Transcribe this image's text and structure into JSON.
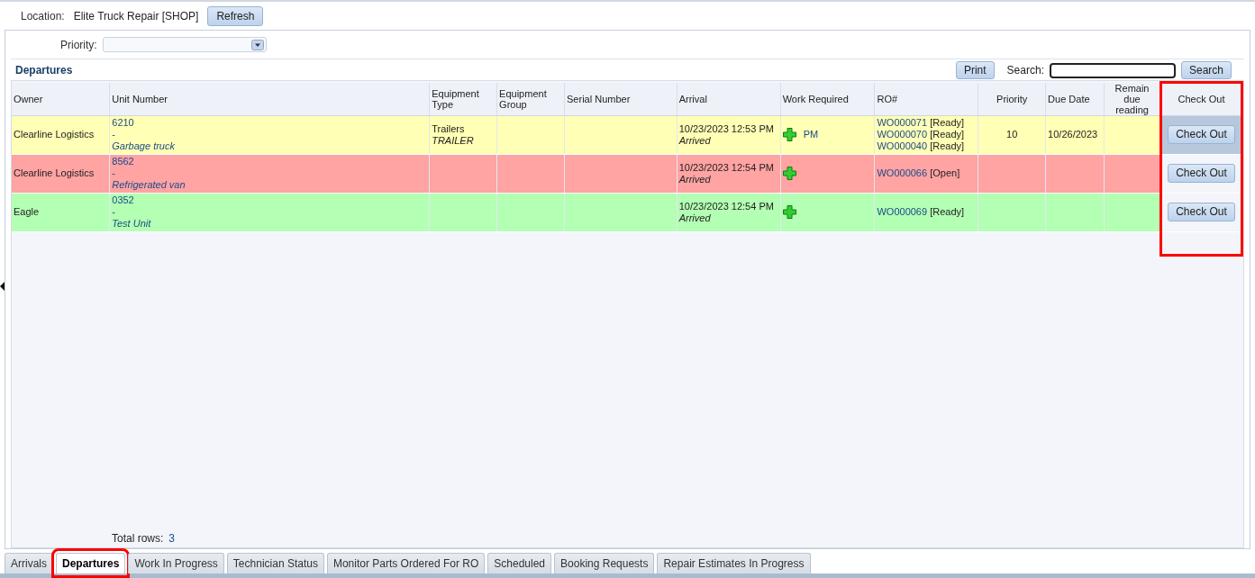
{
  "location": {
    "label": "Location:",
    "value": "Elite Truck Repair [SHOP]"
  },
  "refresh_button": "Refresh",
  "priority_filter": {
    "label": "Priority:"
  },
  "grid": {
    "title": "Departures",
    "print_button": "Print",
    "search_label": "Search:",
    "search_button": "Search",
    "columns": [
      {
        "label": "Owner",
        "highlighted": false
      },
      {
        "label": "Unit Number",
        "highlighted": false
      },
      {
        "label": "Equipment Type",
        "highlighted": false
      },
      {
        "label": "Equipment Group",
        "highlighted": false
      },
      {
        "label": "Serial Number",
        "highlighted": false
      },
      {
        "label": "Arrival",
        "highlighted": false
      },
      {
        "label": "Work Required",
        "highlighted": false
      },
      {
        "label": "RO#",
        "highlighted": false
      },
      {
        "label": "Priority",
        "highlighted": false
      },
      {
        "label": "Due Date",
        "highlighted": false
      },
      {
        "label": "Remain due reading",
        "highlighted": false
      },
      {
        "label": "Check Out",
        "highlighted": true
      }
    ],
    "rows": [
      {
        "color": "#ffffb5",
        "selected": true,
        "owner": "Clearline Logistics",
        "unit_number": "6210",
        "unit_separator": "-",
        "unit_description": "Garbage truck",
        "equipment_type": "Trailers",
        "equipment_type_code": "TRAILER",
        "arrival": "10/23/2023 12:53 PM",
        "arrival_status": "Arrived",
        "work_required": "PM",
        "ro": [
          {
            "number": "WO000071",
            "status": "[Ready]"
          },
          {
            "number": "WO000070",
            "status": "[Ready]"
          },
          {
            "number": "WO000040",
            "status": "[Ready]"
          }
        ],
        "priority": "10",
        "due_date": "10/26/2023",
        "checkout_button": "Check Out"
      },
      {
        "color": "#ffa3a3",
        "selected": false,
        "owner": "Clearline Logistics",
        "unit_number": "8562",
        "unit_separator": "-",
        "unit_description": "Refrigerated van",
        "arrival": "10/23/2023 12:54 PM",
        "arrival_status": "Arrived",
        "ro": [
          {
            "number": "WO000066",
            "status": "[Open]"
          }
        ],
        "checkout_button": "Check Out"
      },
      {
        "color": "#b3ffb3",
        "selected": false,
        "owner": "Eagle",
        "unit_number": "0352",
        "unit_separator": "-",
        "unit_description": "Test Unit",
        "arrival": "10/23/2023 12:54 PM",
        "arrival_status": "Arrived",
        "ro": [
          {
            "number": "WO000069",
            "status": "[Ready]"
          }
        ],
        "checkout_button": "Check Out"
      }
    ],
    "total_label": "Total rows:",
    "total_value": "3"
  },
  "tabs": [
    {
      "label": "Arrivals",
      "selected": false,
      "highlighted": false
    },
    {
      "label": "Departures",
      "selected": true,
      "highlighted": true
    },
    {
      "label": "Work In Progress",
      "selected": false,
      "highlighted": false
    },
    {
      "label": "Technician Status",
      "selected": false,
      "highlighted": false
    },
    {
      "label": "Monitor Parts Ordered For RO",
      "selected": false,
      "highlighted": false
    },
    {
      "label": "Scheduled",
      "selected": false,
      "highlighted": false
    },
    {
      "label": "Booking Requests",
      "selected": false,
      "highlighted": false
    },
    {
      "label": "Repair Estimates In Progress",
      "selected": false,
      "highlighted": false
    }
  ]
}
